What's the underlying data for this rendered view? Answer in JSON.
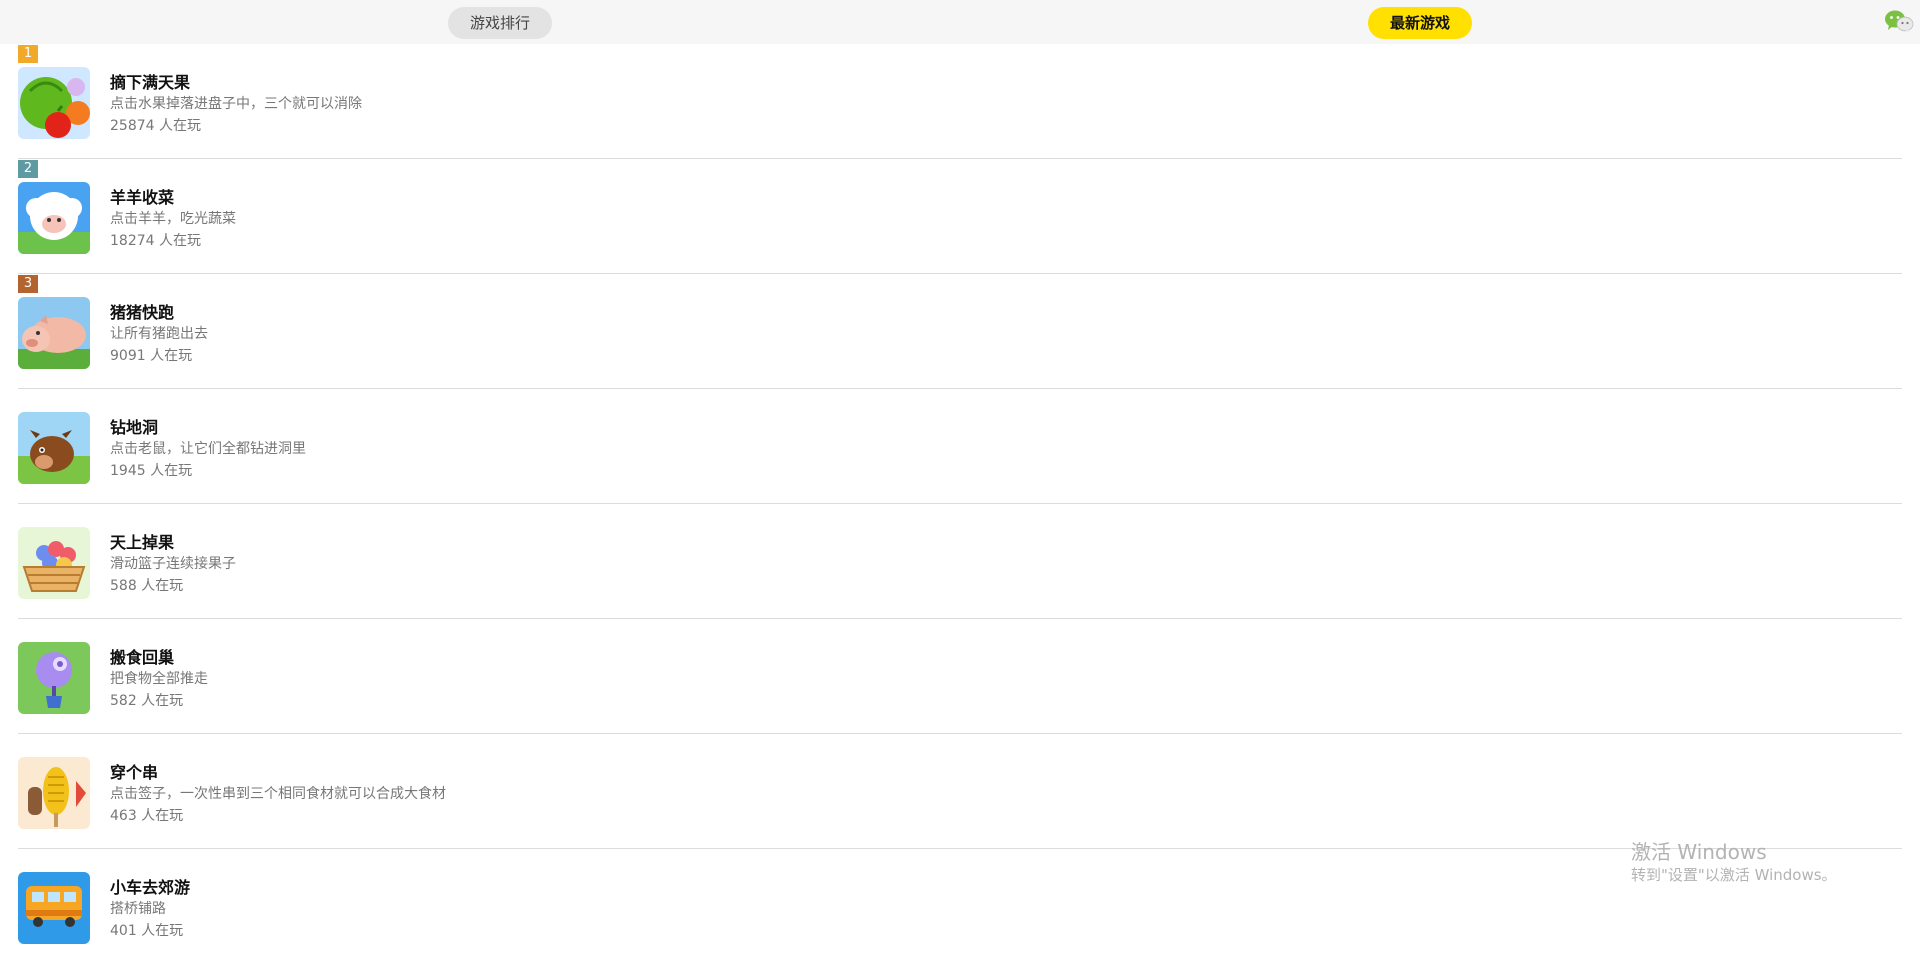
{
  "tabs": {
    "ranking_label": "游戏排行",
    "new_label": "最新游戏"
  },
  "header_icon": "wechat-icon",
  "games": [
    {
      "rank": "1",
      "rank_color": "#f0a92b",
      "name": "摘下满天果",
      "desc": "点击水果掉落进盘子中，三个就可以消除",
      "players": "25874 人在玩",
      "icon": "fruit-icon"
    },
    {
      "rank": "2",
      "rank_color": "#5f9aa2",
      "name": "羊羊收菜",
      "desc": "点击羊羊，吃光蔬菜",
      "players": "18274 人在玩",
      "icon": "sheep-icon"
    },
    {
      "rank": "3",
      "rank_color": "#b3632e",
      "name": "猪猪快跑",
      "desc": "让所有猪跑出去",
      "players": "9091 人在玩",
      "icon": "pig-icon"
    },
    {
      "rank": "",
      "rank_color": "",
      "name": "钻地洞",
      "desc": "点击老鼠，让它们全都钻进洞里",
      "players": "1945 人在玩",
      "icon": "mole-icon"
    },
    {
      "rank": "",
      "rank_color": "",
      "name": "天上掉果",
      "desc": "滑动篮子连续接果子",
      "players": "588 人在玩",
      "icon": "basket-icon"
    },
    {
      "rank": "",
      "rank_color": "",
      "name": "搬食回巢",
      "desc": "把食物全部推走",
      "players": "582 人在玩",
      "icon": "balloon-icon"
    },
    {
      "rank": "",
      "rank_color": "",
      "name": "穿个串",
      "desc": "点击签子，一次性串到三个相同食材就可以合成大食材",
      "players": "463 人在玩",
      "icon": "skewer-icon"
    },
    {
      "rank": "",
      "rank_color": "",
      "name": "小车去郊游",
      "desc": "搭桥铺路",
      "players": "401 人在玩",
      "icon": "bus-icon"
    }
  ],
  "watermark": {
    "line1": "激活 Windows",
    "line2": "转到\"设置\"以激活 Windows。"
  }
}
